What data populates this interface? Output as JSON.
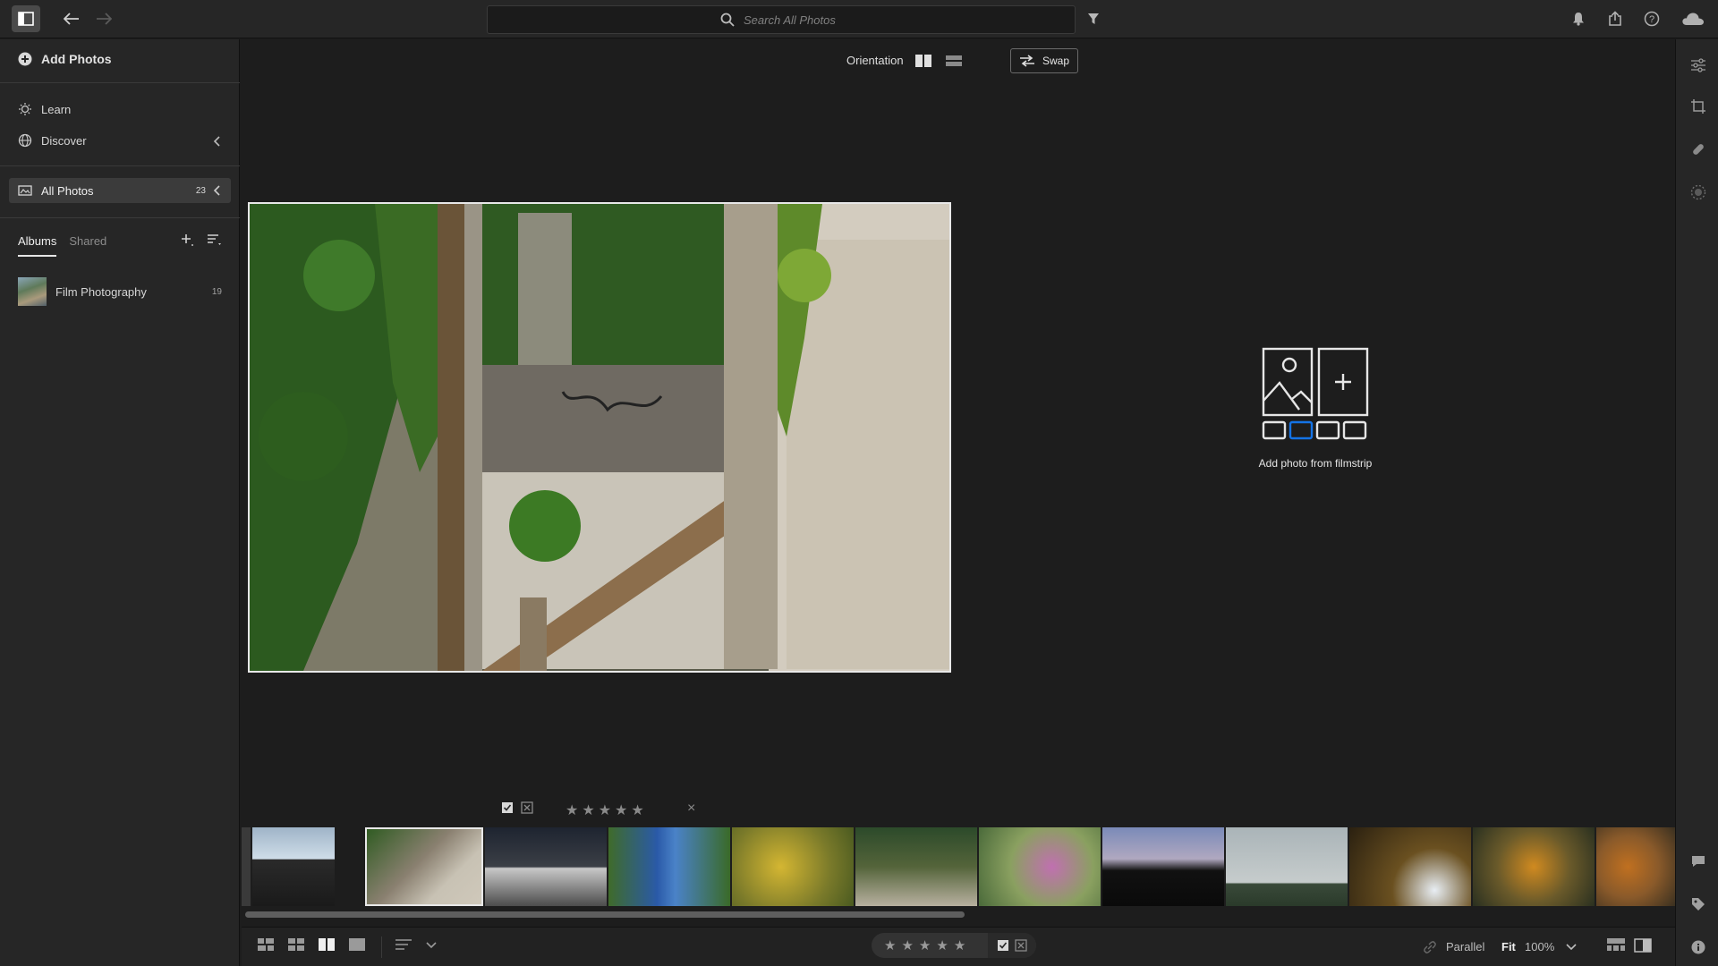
{
  "topbar": {
    "search_placeholder": "Search All Photos",
    "icons": [
      "sidebar-toggle-icon",
      "back-arrow-icon",
      "forward-arrow-icon",
      "search-icon",
      "filter-icon",
      "bell-icon",
      "share-icon",
      "help-icon",
      "cloud-icon"
    ]
  },
  "sidebar": {
    "add_photos_label": "Add Photos",
    "learn_label": "Learn",
    "discover_label": "Discover",
    "all_photos_label": "All Photos",
    "all_photos_count": "23",
    "tabs": {
      "albums": "Albums",
      "shared": "Shared"
    },
    "albums": [
      {
        "name": "Film Photography",
        "count": "19"
      }
    ]
  },
  "compare": {
    "orientation_label": "Orientation",
    "swap_label": "Swap",
    "placeholder_label": "Add photo from filmstrip"
  },
  "rating_row": {
    "stars": [
      "★",
      "★",
      "★",
      "★",
      "★"
    ],
    "clear": "×"
  },
  "bottombar": {
    "parallel_label": "Parallel",
    "fit_label": "Fit",
    "zoom_label": "100%",
    "stars": [
      "★",
      "★",
      "★",
      "★",
      "★"
    ]
  },
  "colors": {
    "background": "#1d1d1d",
    "panel": "#262626",
    "accent_blue": "#1473e6",
    "selection_border": "#e8e8e8"
  }
}
